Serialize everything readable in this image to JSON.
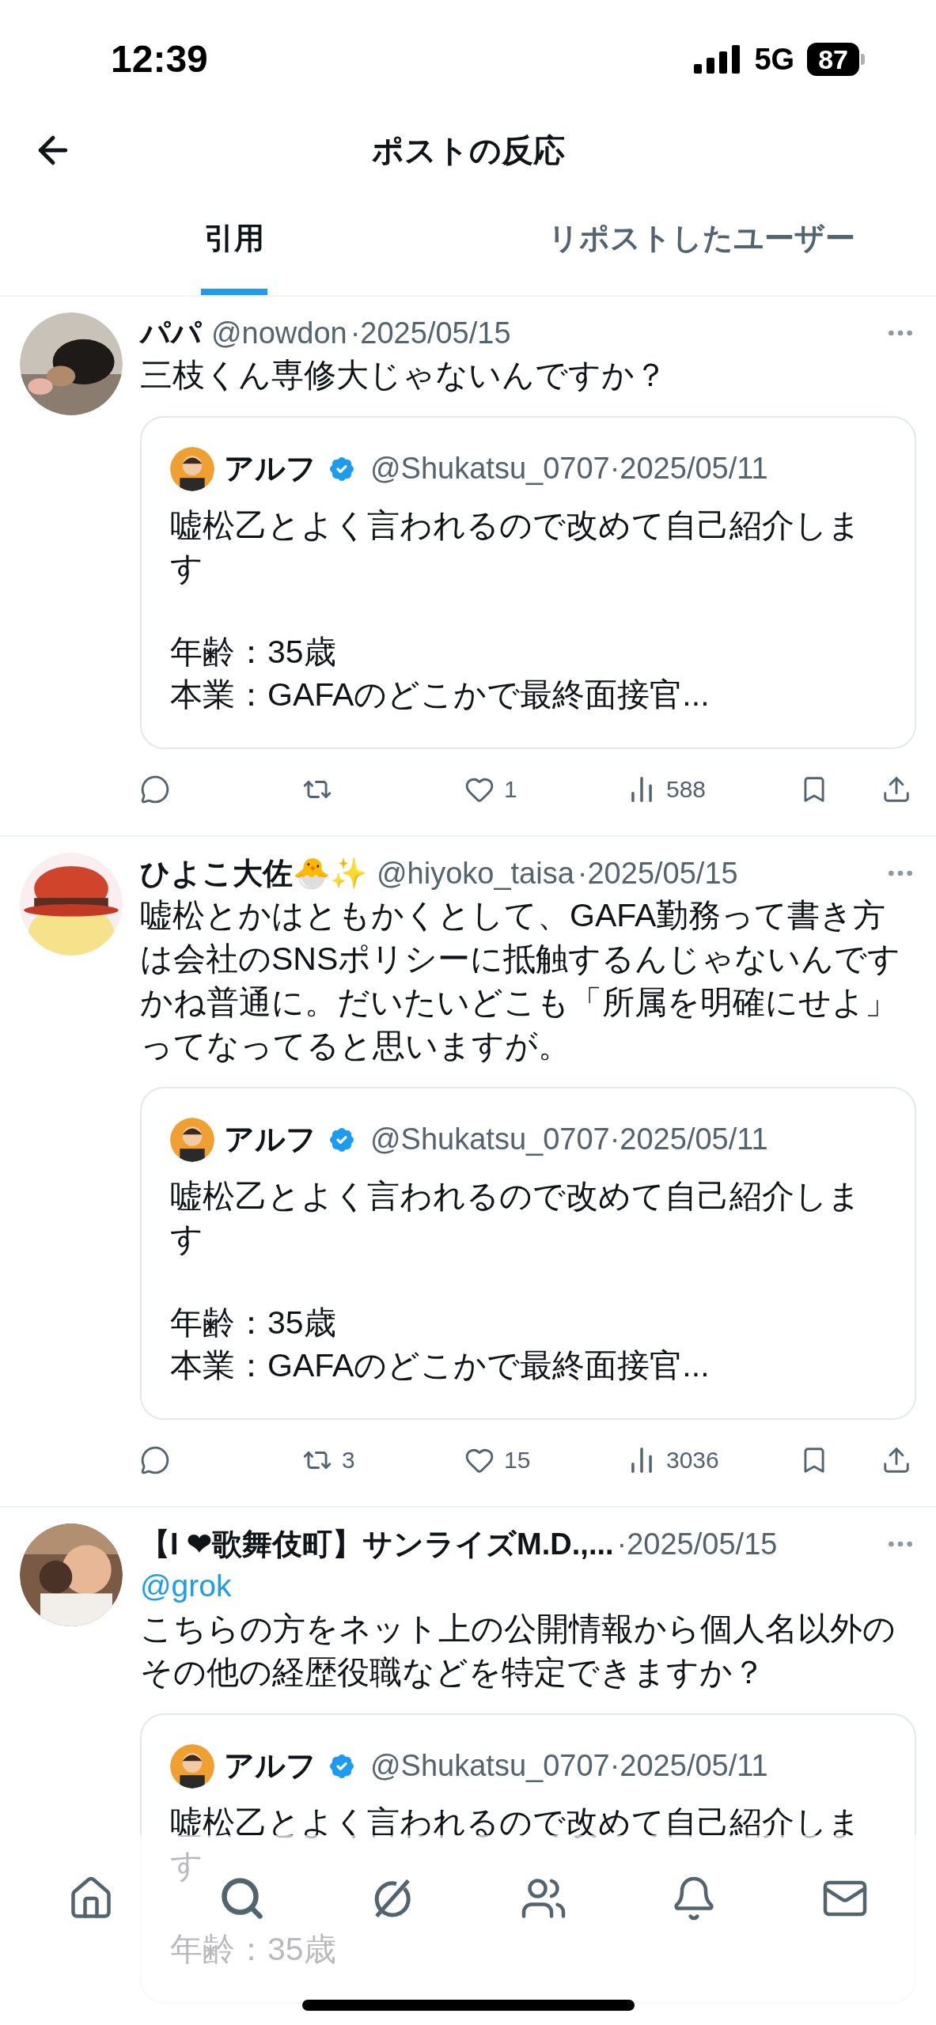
{
  "status_bar": {
    "time": "12:39",
    "network": "5G",
    "battery": "87"
  },
  "header": {
    "title": "ポストの反応"
  },
  "tabs": [
    {
      "label": "引用",
      "selected": true
    },
    {
      "label": "リポストしたユーザー",
      "selected": false
    }
  ],
  "posts": [
    {
      "name": "パパ",
      "handle": "@nowdon",
      "date": "·2025/05/15",
      "text": "三枝くん専修大じゃないんですか？",
      "quote": {
        "name": "アルフ",
        "handle": "@Shukatsu_0707",
        "date": "·2025/05/11",
        "paragraphs": [
          [
            "嘘松乙とよく言われるので改めて自己紹介します"
          ],
          [
            "年齢：35歳",
            "本業：GAFAのどこかで最終面接官..."
          ]
        ]
      },
      "actions": [
        {
          "kind": "reply"
        },
        {
          "kind": "repost"
        },
        {
          "kind": "like",
          "count": "1"
        },
        {
          "kind": "views",
          "count": "588"
        },
        {
          "kind": "bookmark"
        },
        {
          "kind": "share"
        }
      ]
    },
    {
      "name": "ひよこ大佐🐣✨",
      "handle": "@hiyoko_taisa",
      "date": "·2025/05/15",
      "text": "嘘松とかはともかくとして、GAFA勤務って書き方は会社のSNSポリシーに抵触するんじゃないんですかね普通に。だいたいどこも「所属を明確にせよ」ってなってると思いますが。",
      "quote": {
        "name": "アルフ",
        "handle": "@Shukatsu_0707",
        "date": "·2025/05/11",
        "paragraphs": [
          [
            "嘘松乙とよく言われるので改めて自己紹介します"
          ],
          [
            "年齢：35歳",
            "本業：GAFAのどこかで最終面接官..."
          ]
        ]
      },
      "actions": [
        {
          "kind": "reply"
        },
        {
          "kind": "repost",
          "count": "3"
        },
        {
          "kind": "like",
          "count": "15"
        },
        {
          "kind": "views",
          "count": "3036"
        },
        {
          "kind": "bookmark"
        },
        {
          "kind": "share"
        }
      ]
    },
    {
      "name": "【I ❤歌舞伎町】サンライズM.D.,...",
      "date": "·2025/05/15",
      "mention": "@grok",
      "text": "こちらの方をネット上の公開情報から個人名以外のその他の経歴役職などを特定できますか？",
      "quote": {
        "name": "アルフ",
        "handle": "@Shukatsu_0707",
        "date": "·2025/05/11",
        "paragraphs": [
          [
            "嘘松乙とよく言われるので改めて自己紹介します"
          ],
          [
            "年齢：35歳"
          ]
        ]
      }
    }
  ]
}
